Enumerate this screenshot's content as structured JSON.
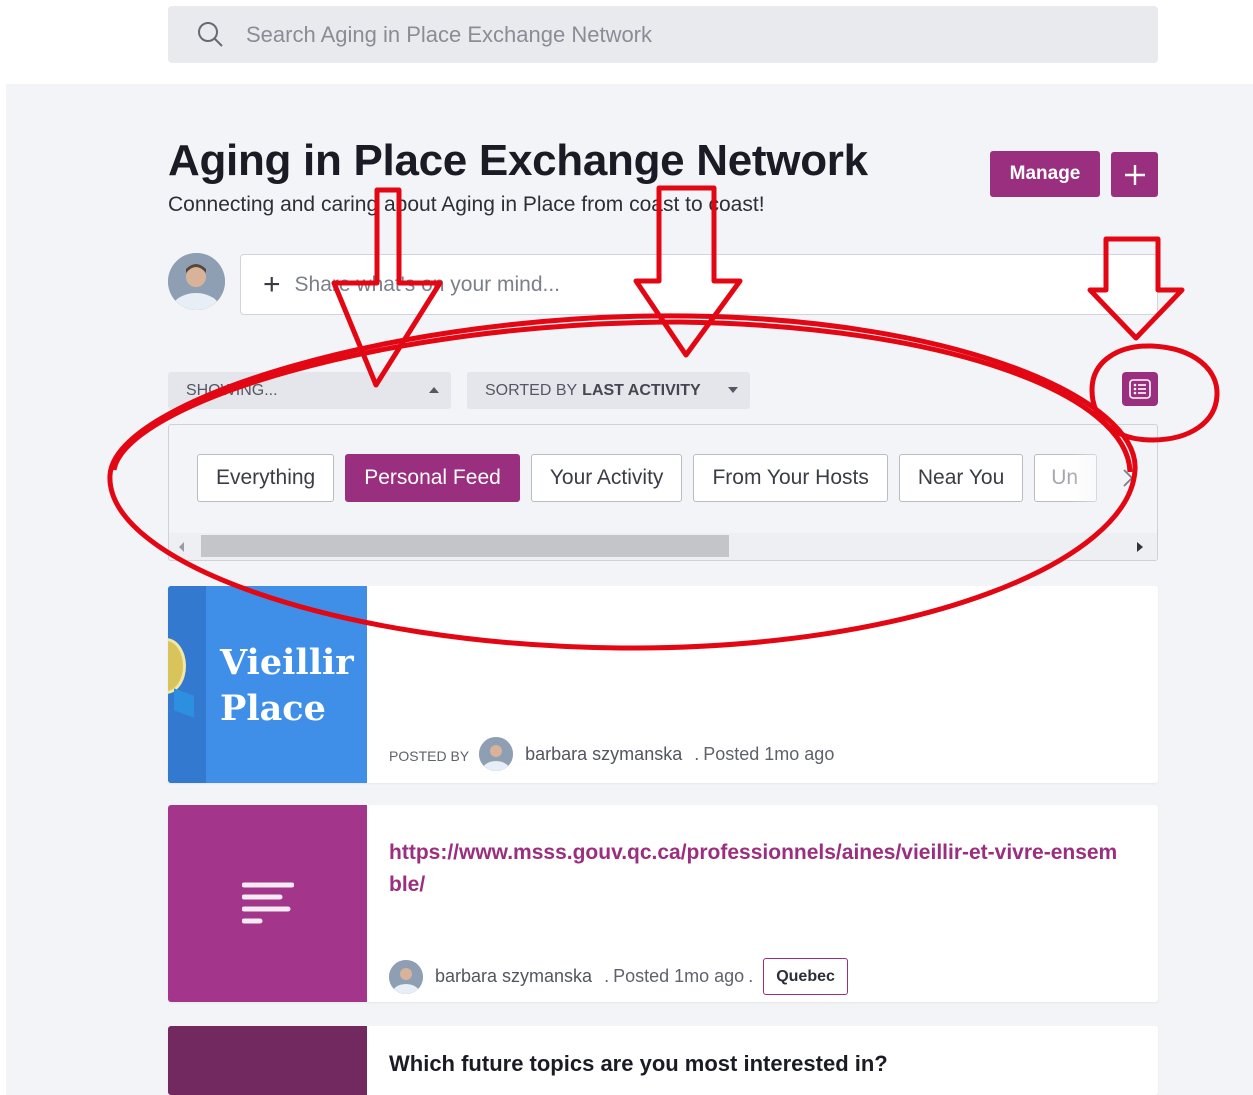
{
  "search": {
    "placeholder": "Search Aging in Place Exchange Network"
  },
  "header": {
    "title": "Aging in Place Exchange Network",
    "subtitle": "Connecting and caring about Aging in Place from coast to coast!",
    "manage_label": "Manage",
    "add_label": "+"
  },
  "composer": {
    "placeholder": "Share what's on your mind..."
  },
  "filters": {
    "showing_label": "SHOWING...",
    "sorted_prefix": "SORTED BY",
    "sorted_value": "LAST ACTIVITY"
  },
  "tabs": [
    {
      "label": "Everything",
      "active": false
    },
    {
      "label": "Personal Feed",
      "active": true
    },
    {
      "label": "Your Activity",
      "active": false
    },
    {
      "label": "From Your Hosts",
      "active": false
    },
    {
      "label": "Near You",
      "active": false
    },
    {
      "label": "Un",
      "active": false
    }
  ],
  "posts": [
    {
      "thumbnail_text": "Vieillir s\nPlace",
      "posted_by_label": "POSTED BY",
      "author": "barbara szymanska",
      "time": "Posted 1mo ago"
    },
    {
      "link": "https://www.msss.gouv.qc.ca/professionnels/aines/vieillir-et-vivre-ensemble/",
      "author": "barbara szymanska",
      "time": "Posted 1mo ago",
      "tag": "Quebec"
    },
    {
      "question": "Which future topics are you most interested in?"
    }
  ],
  "colors": {
    "brand": "#9b2f7f",
    "annotation": "#e30613",
    "background": "#f3f4f7"
  }
}
